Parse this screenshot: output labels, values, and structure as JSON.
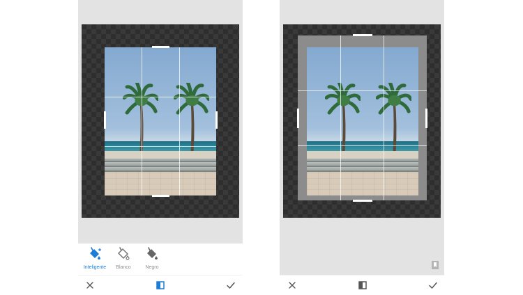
{
  "fill_options": [
    {
      "label": "Inteligente",
      "icon": "paint-bucket-smart-icon",
      "active": true
    },
    {
      "label": "Blanco",
      "icon": "paint-bucket-white-icon",
      "active": false
    },
    {
      "label": "Negro",
      "icon": "paint-bucket-black-icon",
      "active": false
    }
  ],
  "toolbar": {
    "cancel_icon": "close-icon",
    "mode_icon": "expand-mode-icon",
    "apply_icon": "checkmark-icon"
  },
  "colors": {
    "accent": "#1e7cd6",
    "canvas_bg": "#e3e3e3",
    "checker_dark": "#2e2e2e",
    "fill_gray": "#8c8c8c"
  }
}
